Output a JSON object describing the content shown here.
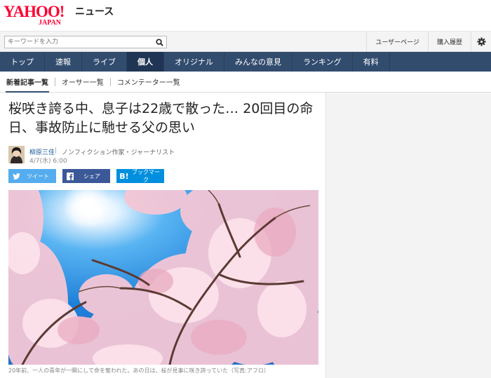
{
  "header": {
    "logo_yahoo": "YAHOO!",
    "logo_japan": "JAPAN",
    "service": "ニュース"
  },
  "search": {
    "placeholder": "キーワードを入力",
    "user_page": "ユーザーページ",
    "purchase_history": "購入履歴",
    "settings_icon": "gear-icon"
  },
  "nav": {
    "items": [
      "トップ",
      "速報",
      "ライブ",
      "個人",
      "オリジナル",
      "みんなの意見",
      "ランキング",
      "有料"
    ],
    "active_index": 3
  },
  "subnav": {
    "items": [
      "新着記事一覧",
      "オーサー一覧",
      "コメンテーター一覧"
    ]
  },
  "article": {
    "title": "桜咲き誇る中、息子は22歳で散った… 20回目の命日、事故防止に馳せる父の思い",
    "author": "柳原三佳",
    "author_sep": "|",
    "author_role": "ノンフィクション作家・ジャーナリスト",
    "date": "4/7(水) 6:00",
    "share": {
      "tweet": "ツイート",
      "share": "シェア",
      "bookmark_icon": "B!",
      "bookmark": "ブックマーク"
    },
    "caption": "20年前、一人の青年が一瞬にして命を奪われた。あの日は、桜が見事に咲き誇っていた（写真:アフロ）"
  },
  "colors": {
    "brand_red": "#ff0033",
    "nav_bg": "#324c6e",
    "twitter": "#55acee",
    "facebook": "#3b5998",
    "hatena": "#008fde"
  }
}
